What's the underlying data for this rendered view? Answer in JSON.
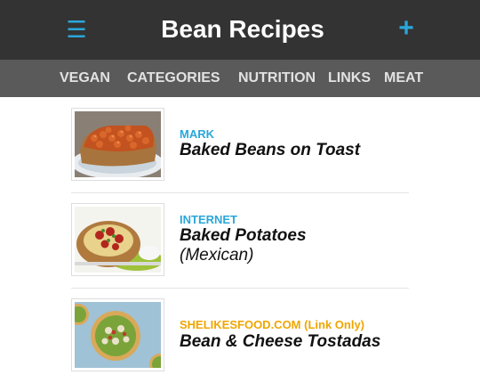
{
  "header": {
    "title": "Bean Recipes",
    "menu_icon": "hamburger-menu-icon",
    "add_icon": "plus-icon",
    "accent_color": "#2aa7d9",
    "background_color": "#333333"
  },
  "nav": {
    "background_color": "#5a5a5a",
    "items": [
      "VEGAN",
      "CATEGORIES",
      "NUTRITION",
      "LINKS",
      "MEAT"
    ]
  },
  "recipes": [
    {
      "source": "MARK",
      "source_color": "#2aa7d9",
      "title": "Baked Beans on Toast",
      "subtitle": "",
      "image": "baked-beans-on-toast-photo"
    },
    {
      "source": "INTERNET",
      "source_color": "#2aa7d9",
      "title": "Baked Potatoes",
      "subtitle": "(Mexican)",
      "image": "baked-potato-photo"
    },
    {
      "source": "SHELIKESFOOD.COM (Link Only)",
      "source_color": "#f0a500",
      "title": "Bean & Cheese Tostadas",
      "subtitle": "",
      "image": "tostadas-photo"
    }
  ]
}
